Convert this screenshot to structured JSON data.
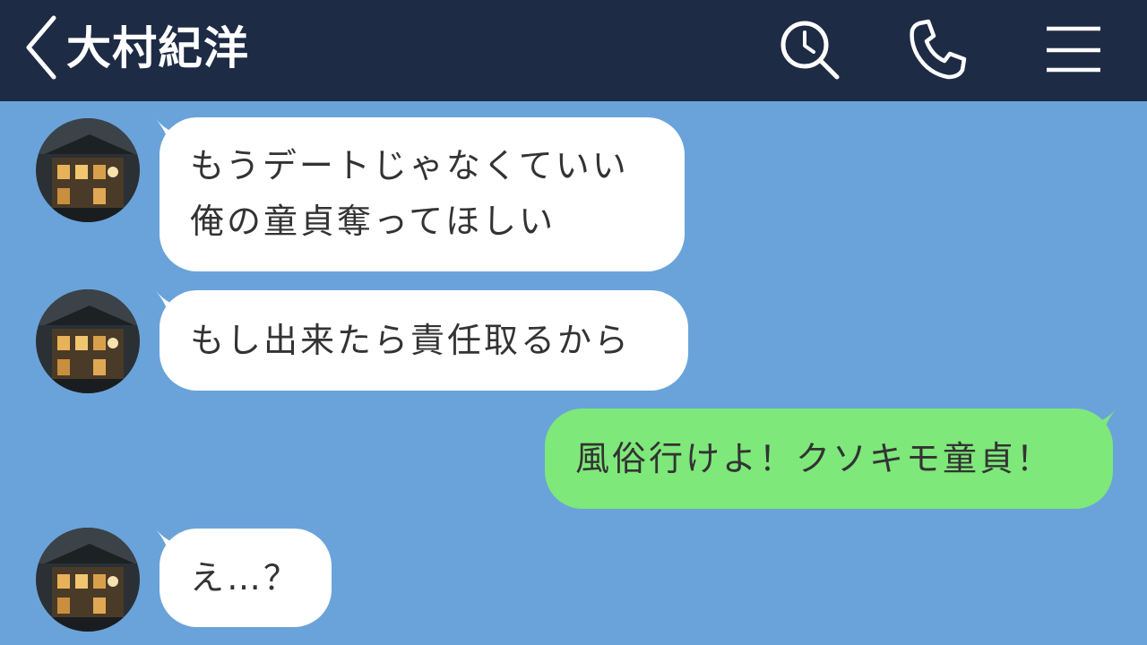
{
  "header": {
    "contact_name": "大村紀洋",
    "icons": [
      "chevron-left-icon",
      "search-clock-icon",
      "phone-icon",
      "menu-icon"
    ]
  },
  "messages": [
    {
      "sender": "contact",
      "lines": [
        "もうデートじゃなくていい",
        "俺の童貞奪ってほしい"
      ]
    },
    {
      "sender": "contact",
      "lines": [
        "もし出来たら責任取るから"
      ]
    },
    {
      "sender": "me",
      "lines": [
        "風俗行けよ！クソキモ童貞！"
      ]
    },
    {
      "sender": "contact",
      "lines": [
        "え…？"
      ]
    }
  ],
  "colors": {
    "header_bg": "#1e2b45",
    "chat_bg": "#6aa3d9",
    "incoming_bubble": "#ffffff",
    "outgoing_bubble": "#7ee87a",
    "text": "#333333"
  }
}
